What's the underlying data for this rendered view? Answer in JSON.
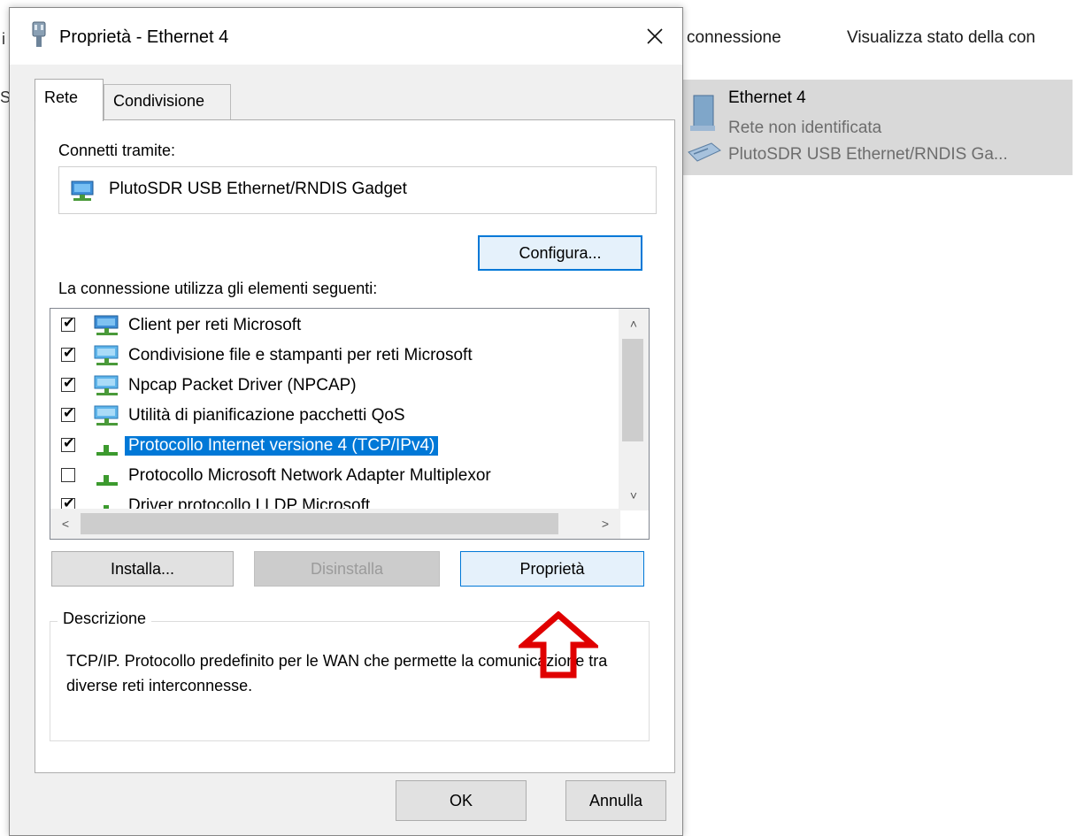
{
  "background": {
    "partial_i": "i",
    "partial_s": "S",
    "commands": [
      "connessione",
      "Visualizza stato della con"
    ],
    "adapter": {
      "name": "Ethernet 4",
      "status": "Rete non identificata",
      "device": "PlutoSDR USB Ethernet/RNDIS Ga..."
    }
  },
  "dialog": {
    "title": "Proprietà - Ethernet 4",
    "close_glyph": "✕",
    "tabs": [
      "Rete",
      "Condivisione"
    ],
    "connect_using_label": "Connetti tramite:",
    "adapter_name": "PlutoSDR USB Ethernet/RNDIS Gadget",
    "configure_label": "Configura...",
    "items_label": "La connessione utilizza gli elementi seguenti:",
    "items": [
      {
        "label": "Client per reti Microsoft",
        "checked": true,
        "icon": "network-client-icon"
      },
      {
        "label": "Condivisione file e stampanti per reti Microsoft",
        "checked": true,
        "icon": "network-service-icon"
      },
      {
        "label": "Npcap Packet Driver (NPCAP)",
        "checked": true,
        "icon": "network-service-icon"
      },
      {
        "label": "Utilità di pianificazione pacchetti QoS",
        "checked": true,
        "icon": "network-service-icon"
      },
      {
        "label": "Protocollo Internet versione 4 (TCP/IPv4)",
        "checked": true,
        "icon": "protocol-icon",
        "selected": true
      },
      {
        "label": "Protocollo Microsoft Network Adapter Multiplexor",
        "checked": false,
        "icon": "protocol-icon"
      },
      {
        "label": "Driver protocollo LLDP Microsoft",
        "checked": true,
        "icon": "protocol-icon"
      }
    ],
    "check_glyph": "✔",
    "scroll_up": "˄",
    "scroll_down": "˅",
    "scroll_left": "<",
    "scroll_right": ">",
    "install_label": "Installa...",
    "uninstall_label": "Disinstalla",
    "properties_label": "Proprietà",
    "description_title": "Descrizione",
    "description_text": "TCP/IP. Protocollo predefinito per le WAN che permette la comunicazione tra diverse reti interconnesse.",
    "ok_label": "OK",
    "cancel_label": "Annulla"
  },
  "colors": {
    "accent": "#0078d7",
    "annotation_arrow": "#e00000"
  }
}
